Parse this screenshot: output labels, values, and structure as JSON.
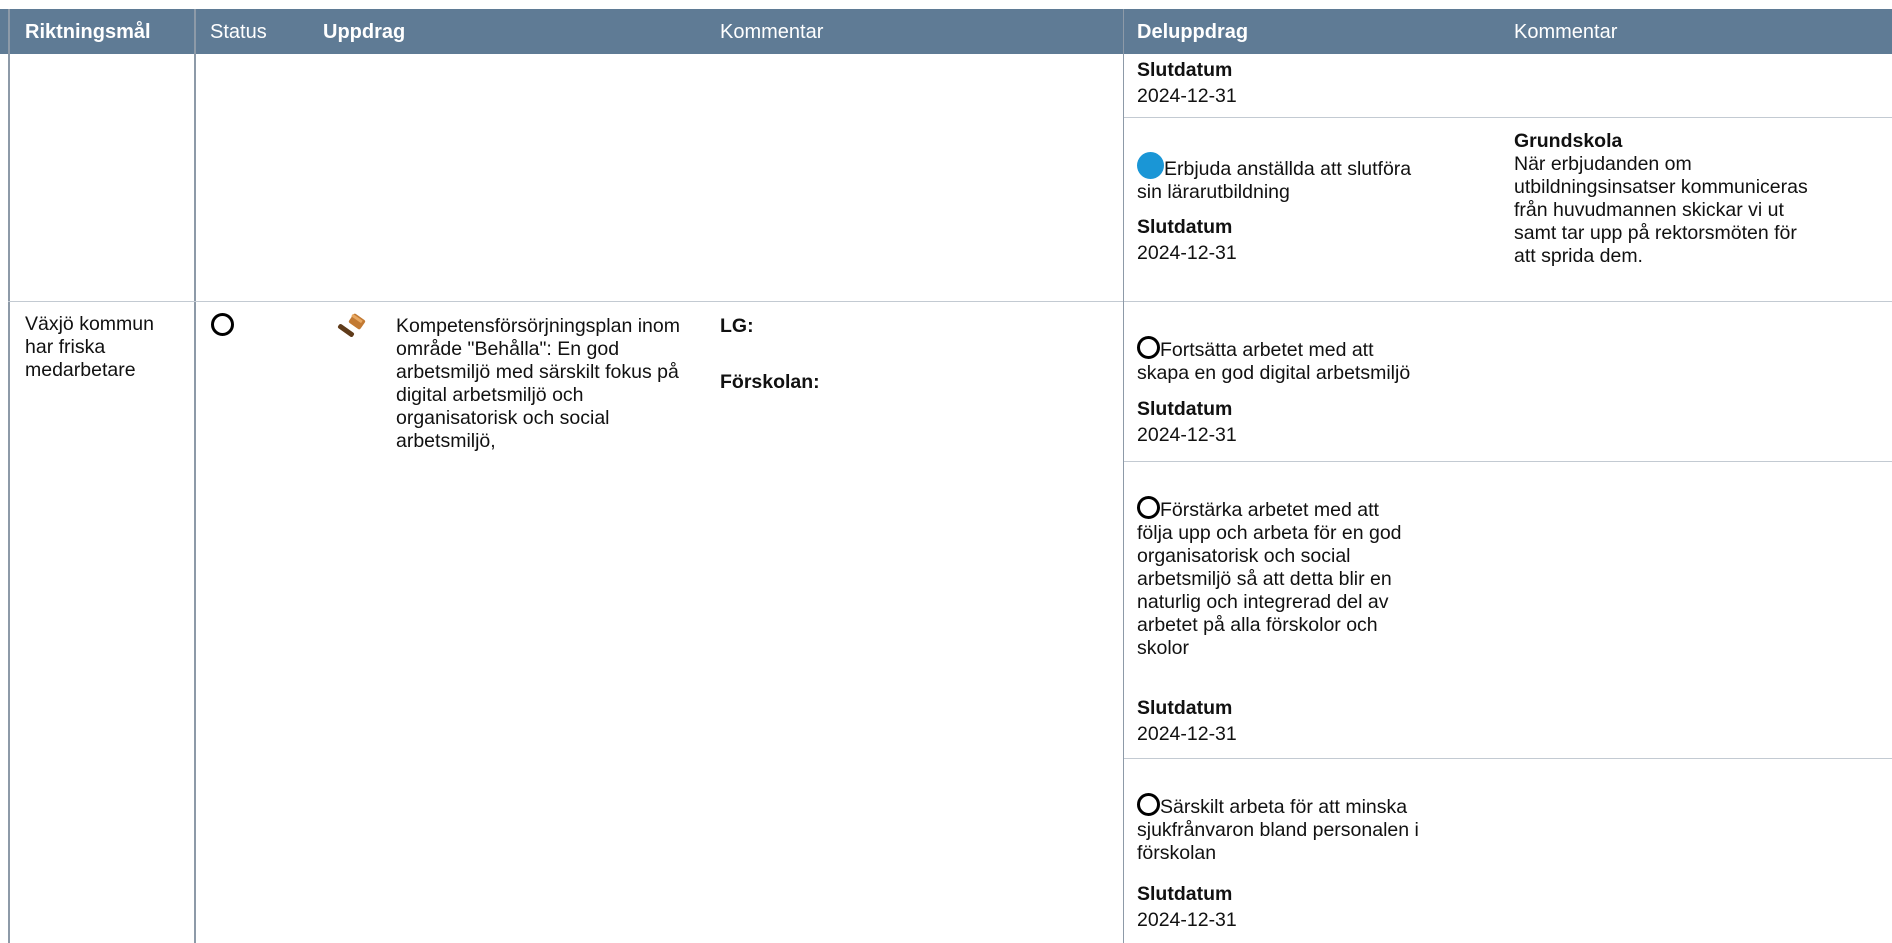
{
  "headers": {
    "riktningsmal": "Riktningsmål",
    "status": "Status",
    "uppdrag": "Uppdrag",
    "kommentar_left": "Kommentar",
    "deluppdrag": "Deluppdrag",
    "kommentar_right": "Kommentar"
  },
  "row": {
    "riktningsmal": "Växjö kommun har friska medarbetare",
    "status_icon": "empty-circle-icon",
    "uppdrag_icon": "gavel-icon",
    "uppdrag_text": "Kompetensförsörjningsplan inom område \"Behålla\": En god arbetsmiljö med särskilt fokus på digital arbetsmiljö och organisatorisk och social arbetsmiljö,",
    "comments": [
      "LG:",
      "Förskolan:"
    ]
  },
  "deluppdrag_label": "Slutdatum",
  "deluppdrag_top": {
    "slutdatum_label": "Slutdatum",
    "slutdatum": "2024-12-31"
  },
  "deluppdrag_items": [
    {
      "status_icon": "blue-dot-icon",
      "text": "Erbjuda anställda att slutföra\nsin lärarutbildning",
      "slutdatum_label": "Slutdatum",
      "slutdatum": "2024-12-31",
      "comment_title": "Grundskola",
      "comment_text": "När erbjudanden om\nutbildningsinsatser kommuniceras\nfrån huvudmannen skickar vi ut\nsamt tar upp på rektorsmöten för\natt sprida dem."
    },
    {
      "status_icon": "empty-circle-icon",
      "text": "Fortsätta arbetet med att\nskapa en god digital arbetsmiljö",
      "slutdatum_label": "Slutdatum",
      "slutdatum": "2024-12-31"
    },
    {
      "status_icon": "empty-circle-icon",
      "text": "Förstärka arbetet med att\nfölja upp och arbeta för en god\norganisatorisk och social\narbetsmiljö så att detta blir en\nnaturlig och integrerad del av\narbetet på alla förskolor och\nskolor",
      "slutdatum_label": "Slutdatum",
      "slutdatum": "2024-12-31"
    },
    {
      "status_icon": "empty-circle-icon",
      "text": "Särskilt arbeta för att minska\nsjukfrånvaron bland personalen i\nförskolan",
      "slutdatum_label": "Slutdatum",
      "slutdatum": "2024-12-31"
    }
  ],
  "colors": {
    "header_bg": "#5f7b95",
    "blue_dot": "#1a96d6",
    "gavel": "#b5651d"
  }
}
